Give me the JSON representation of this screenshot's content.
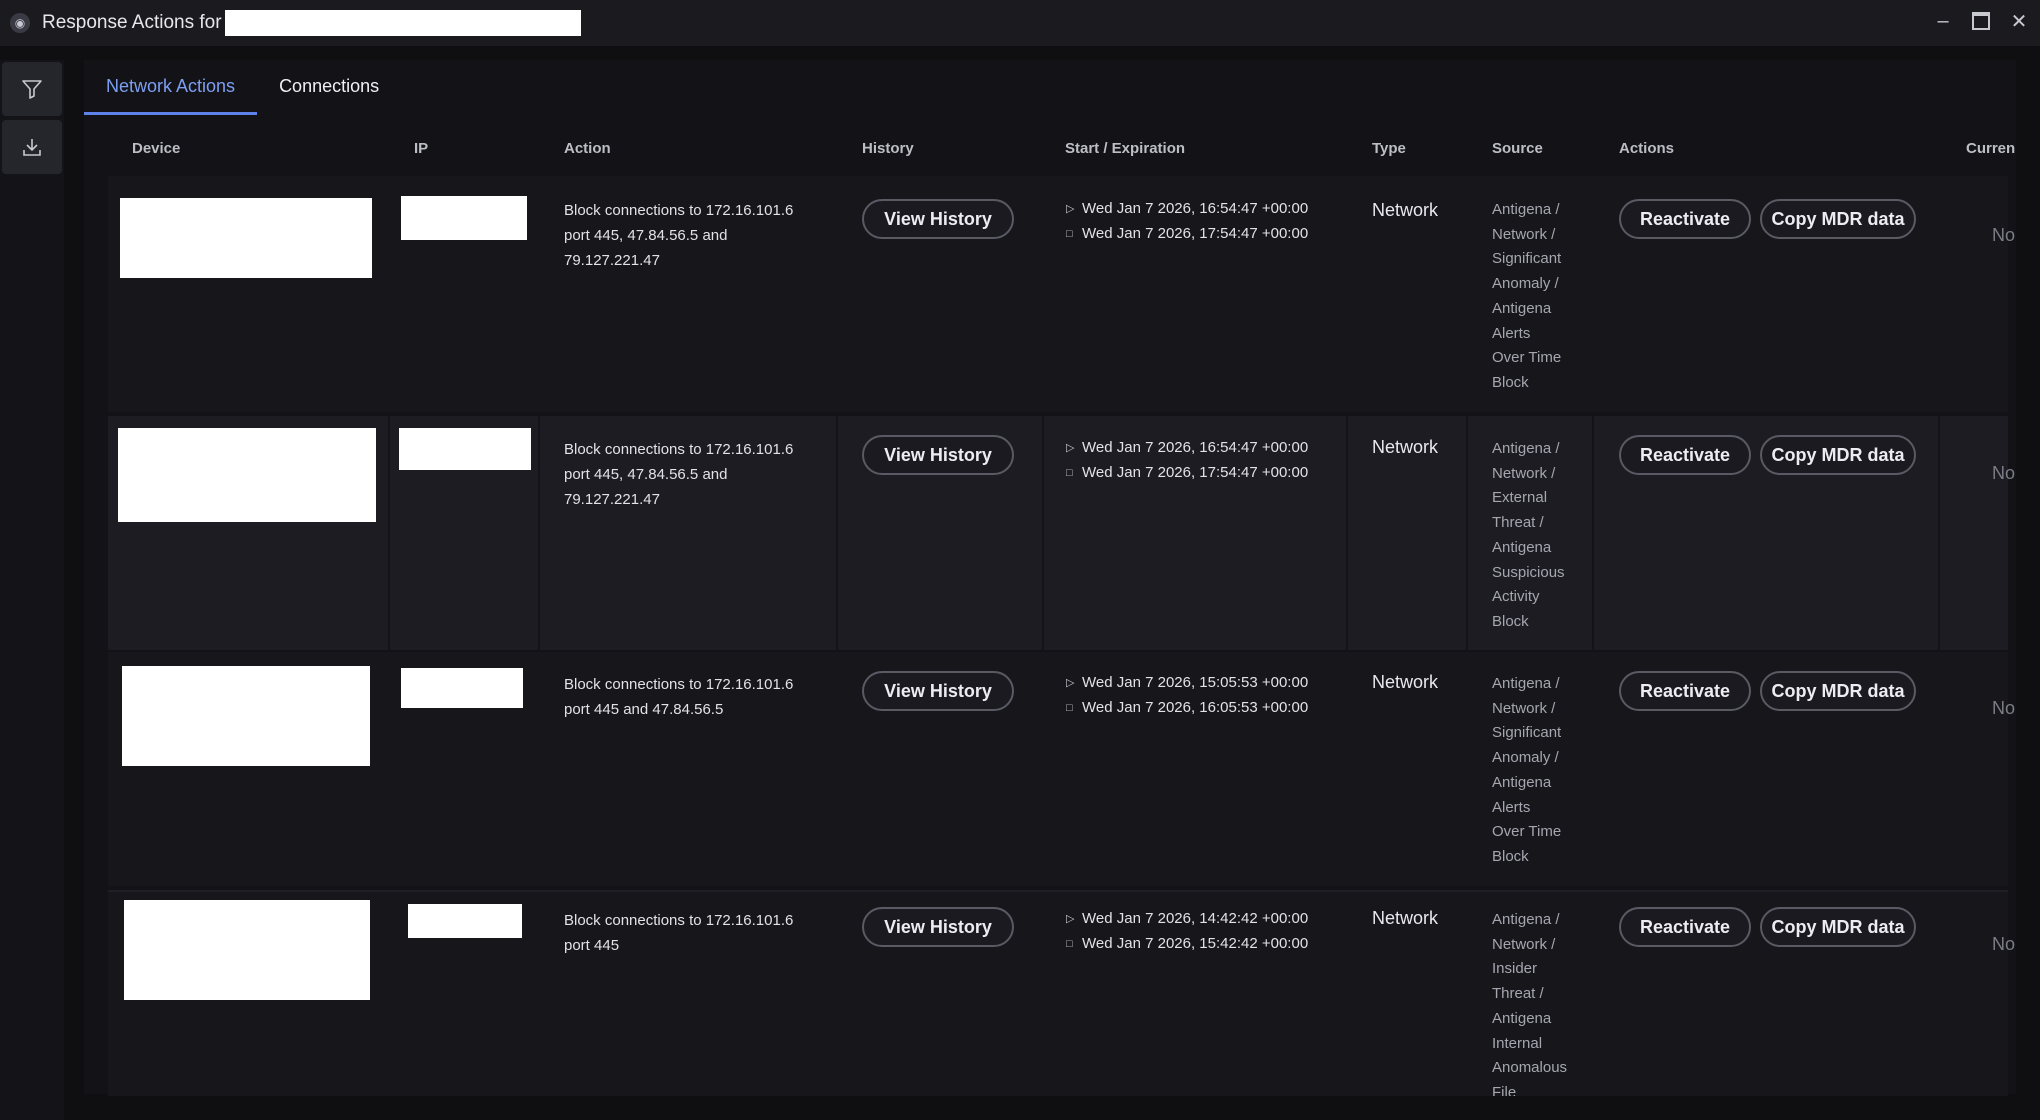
{
  "window": {
    "title": "Response Actions for",
    "icon": "app-logo-icon",
    "controls": [
      "minimize-icon",
      "maximize-icon",
      "close-icon"
    ]
  },
  "sidebar": {
    "items": [
      {
        "icon": "filter-icon"
      },
      {
        "icon": "download-icon"
      }
    ]
  },
  "tabs": [
    {
      "label": "Network Actions",
      "active": true
    },
    {
      "label": "Connections",
      "active": false
    }
  ],
  "columns": [
    "Device",
    "IP",
    "Action",
    "History",
    "Start / Expiration",
    "Type",
    "Source",
    "Actions",
    "Curren"
  ],
  "buttons": {
    "history": "View History",
    "reactivate": "Reactivate",
    "copy": "Copy MDR data"
  },
  "rows": [
    {
      "action_lines": [
        "Block connections to 172.16.101.6",
        "port 445, 47.84.56.5 and",
        "79.127.221.47"
      ],
      "start": "Wed Jan 7 2026, 16:54:47 +00:00",
      "expiration": "Wed Jan 7 2026, 17:54:47 +00:00",
      "type": "Network",
      "source_lines": [
        "Antigena /",
        "Network /",
        "Significant",
        "Anomaly /",
        "Antigena",
        "Alerts",
        "Over Time",
        "Block"
      ],
      "current": "No"
    },
    {
      "action_lines": [
        "Block connections to 172.16.101.6",
        "port 445, 47.84.56.5 and",
        "79.127.221.47"
      ],
      "start": "Wed Jan 7 2026, 16:54:47 +00:00",
      "expiration": "Wed Jan 7 2026, 17:54:47 +00:00",
      "type": "Network",
      "source_lines": [
        "Antigena /",
        "Network /",
        "External",
        "Threat /",
        "Antigena",
        "Suspicious",
        "Activity",
        "Block"
      ],
      "current": "No"
    },
    {
      "action_lines": [
        "Block connections to 172.16.101.6",
        "port 445 and 47.84.56.5"
      ],
      "start": "Wed Jan 7 2026, 15:05:53 +00:00",
      "expiration": "Wed Jan 7 2026, 16:05:53 +00:00",
      "type": "Network",
      "source_lines": [
        "Antigena /",
        "Network /",
        "Significant",
        "Anomaly /",
        "Antigena",
        "Alerts",
        "Over Time",
        "Block"
      ],
      "current": "No"
    },
    {
      "action_lines": [
        "Block connections to 172.16.101.6",
        "port 445"
      ],
      "start": "Wed Jan 7 2026, 14:42:42 +00:00",
      "expiration": "Wed Jan 7 2026, 15:42:42 +00:00",
      "type": "Network",
      "source_lines": [
        "Antigena /",
        "Network /",
        "Insider",
        "Threat /",
        "Antigena",
        "Internal",
        "Anomalous",
        "File"
      ],
      "current": "No"
    }
  ]
}
